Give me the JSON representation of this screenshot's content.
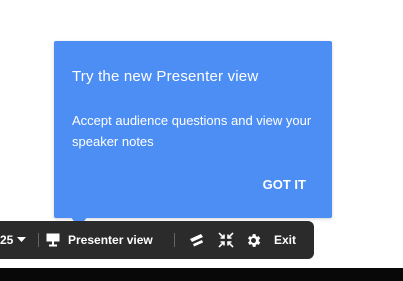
{
  "popup": {
    "title": "Try the new Presenter view",
    "body": "Accept audience questions and view your speaker notes",
    "button": "GOT IT",
    "color": "#4d8ef5"
  },
  "toolbar": {
    "slide_number": "25",
    "presenter_label": "Presenter view",
    "exit_label": "Exit",
    "icons": [
      "chevron-down-icon",
      "presenter-screen-icon",
      "laser-pointer-icon",
      "exit-fullscreen-icon",
      "gear-icon"
    ],
    "color": "#2b2b2b"
  }
}
